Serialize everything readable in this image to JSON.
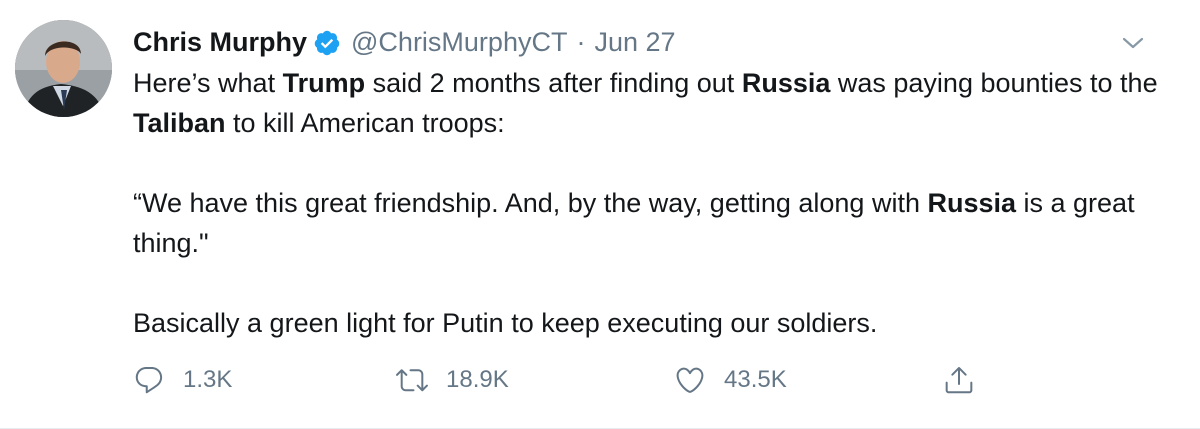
{
  "tweet": {
    "author": {
      "name": "Chris Murphy",
      "handle": "@ChrisMurphyCT",
      "verified_icon": "verified-badge-icon",
      "avatar": "avatar"
    },
    "separator": "·",
    "date": "Jun 27",
    "text": {
      "p1": {
        "s1": "Here’s what ",
        "b1": "Trump",
        "s2": " said 2 months after finding out ",
        "b2": "Russia",
        "s3": " was paying bounties to the ",
        "b3": "Taliban",
        "s4": " to kill American troops:"
      },
      "p2": {
        "s1": "“We have this great friendship. And, by the way, getting along with ",
        "b1": "Russia",
        "s2": " is a great thing.\""
      },
      "p3": "Basically a green light for Putin to keep executing our soldiers."
    },
    "actions": {
      "reply": {
        "icon": "reply-icon",
        "count": "1.3K"
      },
      "retweet": {
        "icon": "retweet-icon",
        "count": "18.9K"
      },
      "like": {
        "icon": "heart-icon",
        "count": "43.5K"
      },
      "share": {
        "icon": "share-icon"
      }
    },
    "more_icon": "chevron-down-icon"
  },
  "colors": {
    "text": "#14171a",
    "secondary": "#657786",
    "verified": "#1da1f2",
    "border": "#e6ecf0"
  }
}
